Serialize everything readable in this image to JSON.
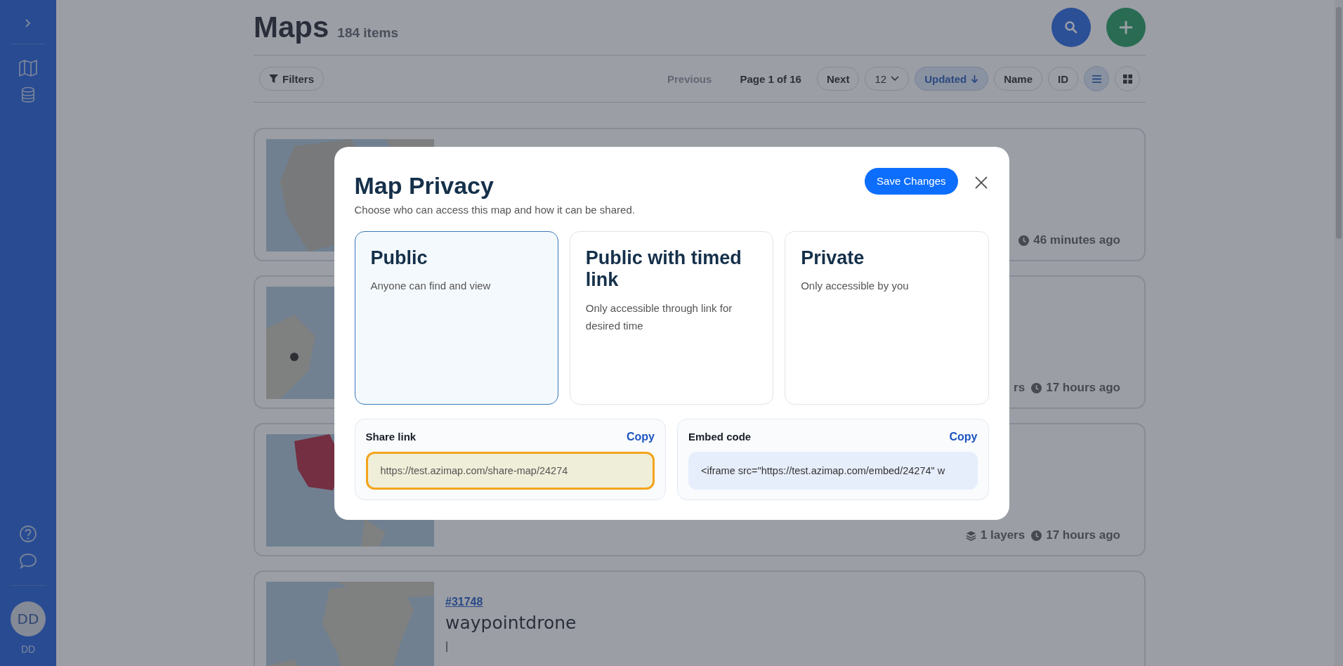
{
  "sidebar": {
    "user": {
      "initials": "DD",
      "name": "DD"
    }
  },
  "header": {
    "title": "Maps",
    "count": "184 items"
  },
  "toolbar": {
    "filters": "Filters",
    "previous": {
      "label": "Previous",
      "disabled": true
    },
    "page": "Page 1 of 16",
    "next": {
      "label": "Next",
      "disabled": false
    },
    "per_page": "12",
    "sorts": [
      {
        "label": "Updated",
        "selected": true
      },
      {
        "label": "Name",
        "selected": false
      },
      {
        "label": "ID",
        "selected": false
      }
    ],
    "views": [
      {
        "kind": "list",
        "selected": true
      },
      {
        "kind": "grid",
        "selected": false
      }
    ]
  },
  "cards": [
    {
      "meta": [
        {
          "kind": "time",
          "text": "46 minutes ago"
        }
      ]
    },
    {
      "meta": [
        {
          "kind": "text",
          "text": "rs"
        },
        {
          "kind": "time",
          "text": "17 hours ago"
        }
      ]
    },
    {
      "meta": [
        {
          "kind": "layers",
          "text": "1 layers"
        },
        {
          "kind": "time",
          "text": "17 hours ago"
        }
      ]
    },
    {
      "id": "#31748",
      "title": "waypointdrone",
      "description": "|"
    }
  ],
  "modal": {
    "title": "Map Privacy",
    "subtitle": "Choose who can access this map and how it can be shared.",
    "save": "Save Changes",
    "options": [
      {
        "title": "Public",
        "description": "Anyone can find and view",
        "selected": true
      },
      {
        "title": "Public with timed link",
        "description": "Only accessible through link for desired time",
        "selected": false
      },
      {
        "title": "Private",
        "description": "Only accessible by you",
        "selected": false
      }
    ],
    "share": {
      "label": "Share link",
      "copy": "Copy",
      "value": "https://test.azimap.com/share-map/24274",
      "focused": true
    },
    "embed": {
      "label": "Embed code",
      "copy": "Copy",
      "value": "<iframe src=\"https://test.azimap.com/embed/24274\" w"
    }
  }
}
